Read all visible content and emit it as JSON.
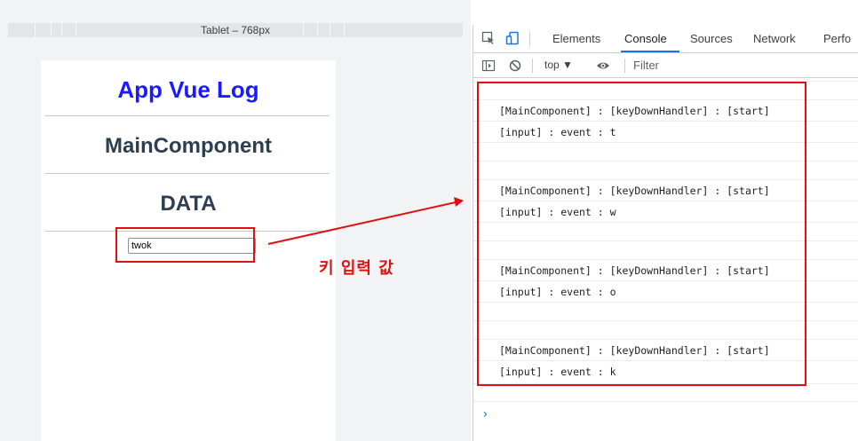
{
  "device_toolbar": {
    "label": "Tablet – 768px"
  },
  "app": {
    "title": "App Vue Log",
    "component_title": "MainComponent",
    "data_title": "DATA",
    "input_value": "twok"
  },
  "annotation": {
    "label": "키 입력 값",
    "color": "#e01010"
  },
  "devtools": {
    "tabs": [
      "Elements",
      "Console",
      "Sources",
      "Network",
      "Perfo"
    ],
    "active_tab": "Console",
    "context": "top ▼",
    "filter_placeholder": "Filter",
    "logs": [
      "[MainComponent] : [keyDownHandler] : [start]",
      "[input] : event : t",
      "[MainComponent] : [keyDownHandler] : [start]",
      "[input] : event : w",
      "[MainComponent] : [keyDownHandler] : [start]",
      "[input] : event : o",
      "[MainComponent] : [keyDownHandler] : [start]",
      "[input] : event : k"
    ],
    "prompt": "›"
  },
  "colors": {
    "app_title": "#1a1aff",
    "heading": "#2c3e50",
    "accent": "#1a73e8"
  }
}
